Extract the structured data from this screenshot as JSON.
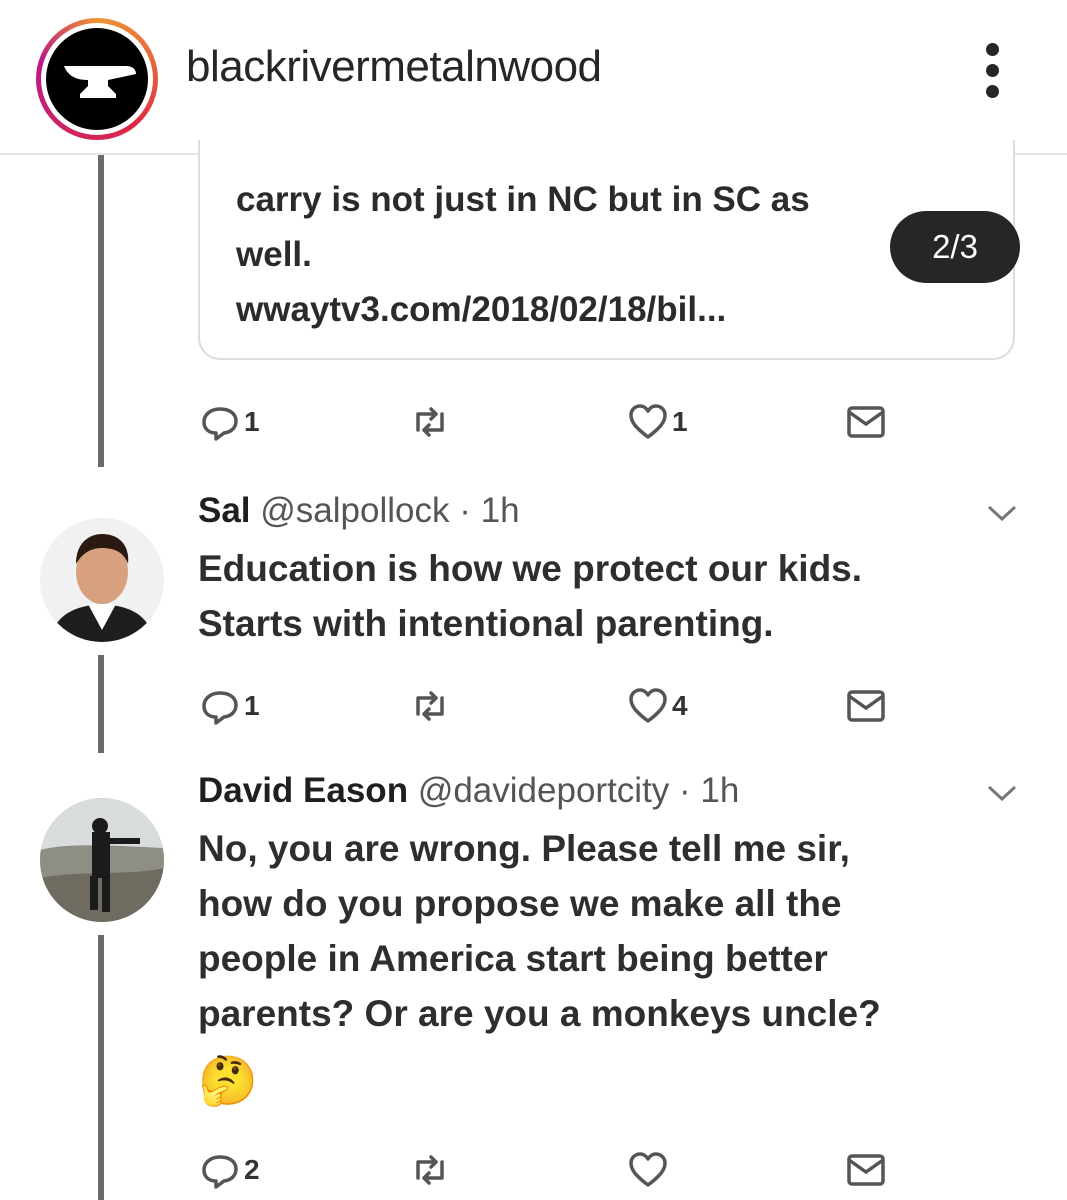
{
  "post": {
    "username": "blackrivermetalnwood",
    "slide_counter": "2/3",
    "profile_icon": "anvil-icon"
  },
  "quoted_tweet": {
    "text_line1": "carry is not just in NC but in SC as",
    "text_line2": "well.",
    "link": "wwaytv3.com/2018/02/18/bil...",
    "actions": {
      "replies": "1",
      "retweets": "",
      "likes": "1"
    }
  },
  "tweets": [
    {
      "name": "Sal",
      "handle": "@salpollock",
      "time": "· 1h",
      "text": "Education is how we protect our kids.\nStarts with intentional parenting.",
      "actions": {
        "replies": "1",
        "retweets": "",
        "likes": "4"
      }
    },
    {
      "name": "David Eason",
      "handle": "@davideportcity",
      "time": "· 1h",
      "text": "No, you are wrong. Please tell me sir,\nhow do you propose we make all the\npeople in America start being better\nparents? Or are you a monkeys uncle?",
      "emoji": "🤔",
      "actions": {
        "replies": "2",
        "retweets": "",
        "likes": ""
      }
    }
  ],
  "icons": {
    "reply": "reply-icon",
    "retweet": "retweet-icon",
    "like": "heart-icon",
    "dm": "mail-icon",
    "more": "more-vertical-icon",
    "caret": "chevron-down-icon"
  }
}
